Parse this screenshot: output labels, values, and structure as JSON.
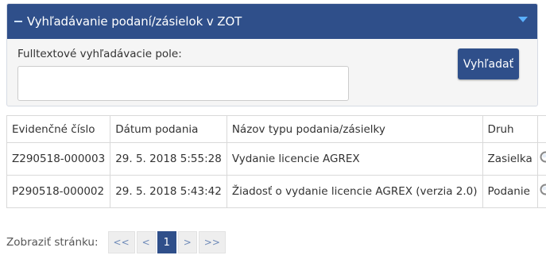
{
  "panel": {
    "title": "Vyhľadávanie podaní/zásielok v ZOT",
    "field_label": "Fulltextové vyhľadávacie pole:",
    "search_value": "",
    "search_button": "Vyhľadať"
  },
  "table": {
    "headers": [
      "Evidenčné číslo",
      "Dátum podania",
      "Názov typu podania/zásielky",
      "Druh"
    ],
    "rows": [
      {
        "number": "Z290518-000003",
        "date": "29. 5. 2018 5:55:28",
        "name": "Vydanie licencie AGREX",
        "kind": "Zasielka",
        "action_icon": "magnifier-icon"
      },
      {
        "number": "P290518-000002",
        "date": "29. 5. 2018 5:43:42",
        "name": "Žiadosť o vydanie licencie AGREX (verzia 2.0)",
        "kind": "Podanie",
        "action_icon": "magnifier-icon"
      }
    ]
  },
  "pager": {
    "label": "Zobraziť stránku:",
    "first": "<<",
    "prev": "<",
    "current": "1",
    "next": ">",
    "last": ">>"
  },
  "colors": {
    "header_bg": "#2f4f8a",
    "accent_chevron": "#5ab0ff",
    "pager_link": "#6e8ab8"
  }
}
